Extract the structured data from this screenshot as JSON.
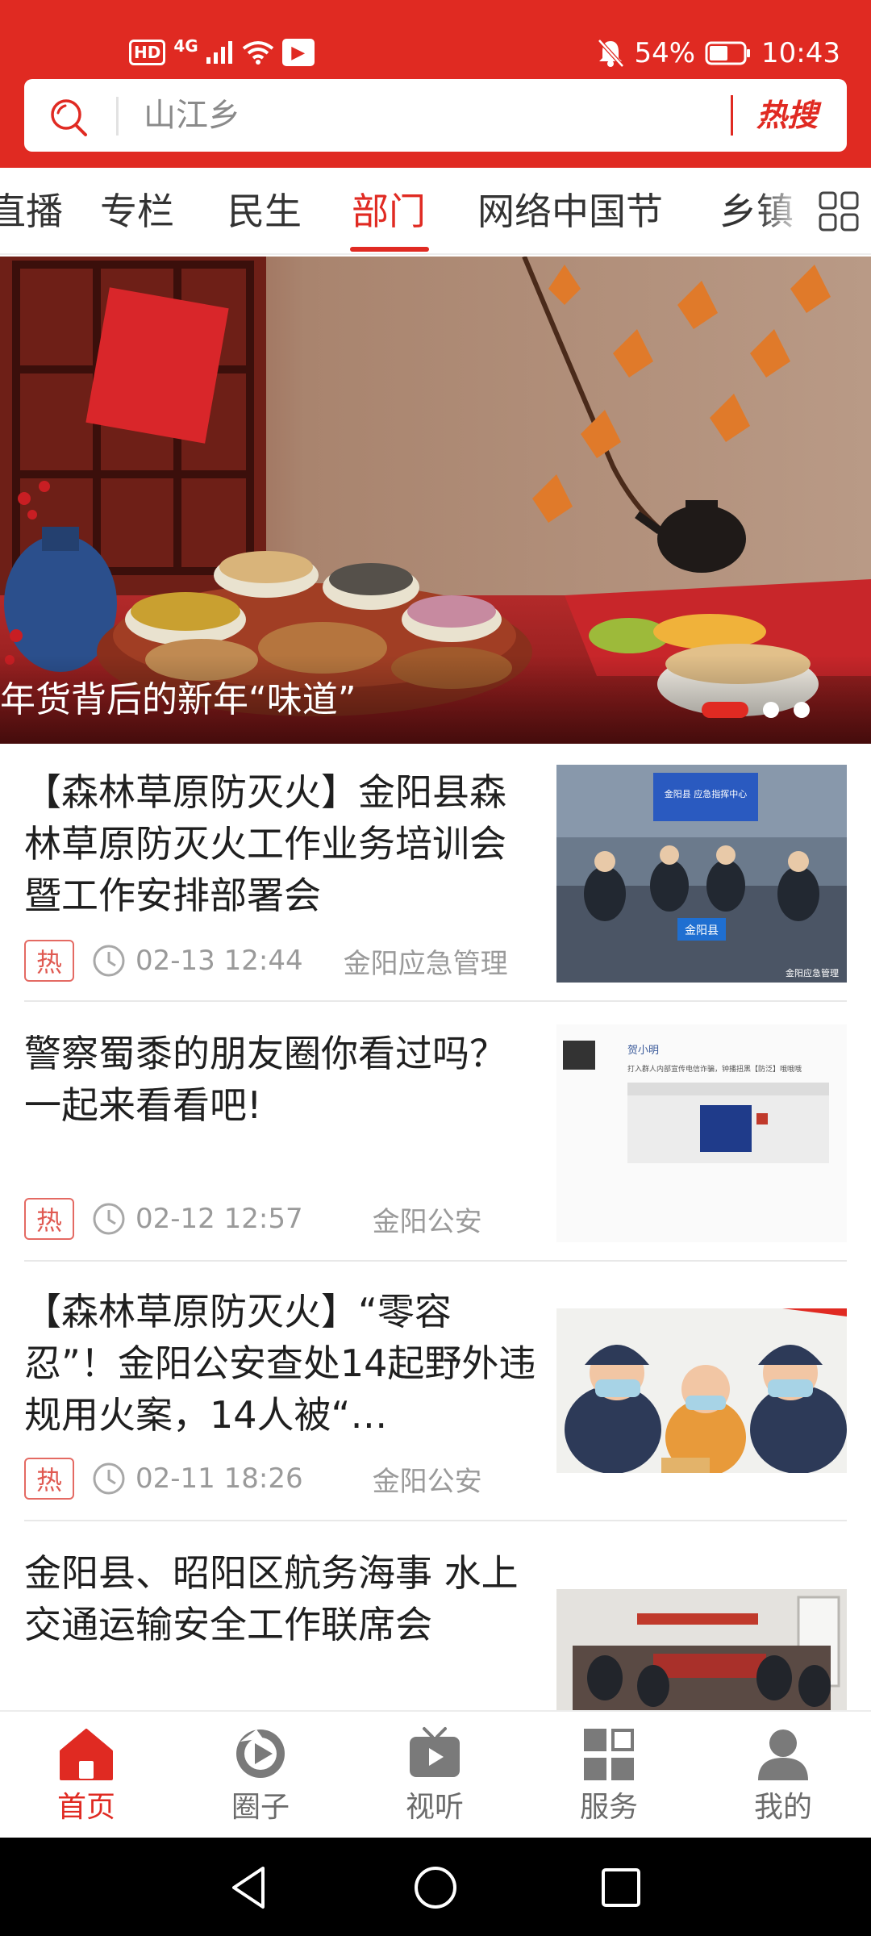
{
  "status_bar": {
    "hd": "HD",
    "network": "4G",
    "battery": "54%",
    "time": "10:43"
  },
  "search": {
    "query": "山江乡",
    "hot_label": "热搜"
  },
  "tabs": [
    "直播",
    "专栏",
    "民生",
    "部门",
    "网络中国节",
    "乡镇"
  ],
  "active_tab": "部门",
  "banner": {
    "caption": "年货背后的新年“味道”",
    "slide_index": 1,
    "slide_count": 3
  },
  "news": [
    {
      "title": "【森林草原防灭火】金阳县森林草原防灭火工作业务培训会暨工作安排部署会",
      "hot": "热",
      "time": "02-13 12:44",
      "source": "金阳应急管理",
      "thumb_banner": "金阳县 应急指挥中心",
      "thumb_nameplate": "金阳县",
      "thumb_watermark": "金阳应急管理"
    },
    {
      "title": "警察蜀黍的朋友圈你看过吗？一起来看看吧!",
      "hot": "热",
      "time": "02-12 12:57",
      "source": "金阳公安",
      "thumb_name": "贺小明",
      "thumb_text": "打入群人内部宣传电信诈骗，钟播扭黑【防泛】哦哦哦"
    },
    {
      "title": "【森林草原防灭火】“零容忍”！金阳公安查处14起野外违规用火案，14人被“…",
      "hot": "热",
      "time": "02-11 18:26",
      "source": "金阳公安"
    },
    {
      "title": "金阳县、昭阳区航务海事 水上交通运输安全工作联席会",
      "hot": "",
      "time": "",
      "source": ""
    }
  ],
  "bottom_nav": [
    {
      "label": "首页",
      "icon": "home-icon",
      "active": true
    },
    {
      "label": "圈子",
      "icon": "circle-icon",
      "active": false
    },
    {
      "label": "视听",
      "icon": "tv-icon",
      "active": false
    },
    {
      "label": "服务",
      "icon": "grid-icon",
      "active": false
    },
    {
      "label": "我的",
      "icon": "profile-icon",
      "active": false
    }
  ],
  "colors": {
    "brand_red": "#e02a22",
    "text_gray": "#9a9a9a"
  }
}
